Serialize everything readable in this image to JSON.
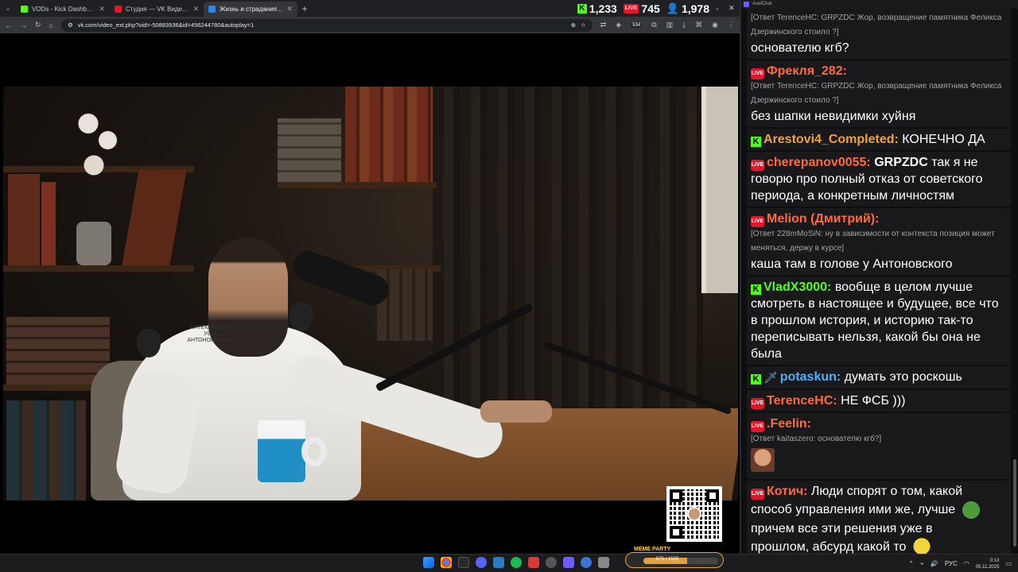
{
  "browser": {
    "tabs": [
      {
        "title": "VODs - Kick Dashboard",
        "favicon_color": "#53fc18",
        "active": false
      },
      {
        "title": "Студия — VK Видео Live",
        "favicon_color": "#e0162b",
        "active": false
      },
      {
        "title": "Жизнь и страдания Роман",
        "favicon_color": "#2787f5",
        "active": true
      }
    ],
    "new_tab": "+",
    "url": "vk.com/video_ext.php?oid=-50883936&id=456244780&autoplay=1",
    "counters": {
      "kick": "1,233",
      "vk": "745",
      "viewers": "1,978"
    },
    "badge": "534"
  },
  "video": {
    "shirt_text": "АПТЕКАРСКИЕ УСЫ АНТОНОВСКОГО"
  },
  "chat": {
    "window_title": "AxelChat",
    "messages": [
      {
        "platform": "",
        "name": "",
        "name_color": "#ffffff",
        "reply": "[Ответ TerenceHC: GRPZDC Жор, возвращение памятника Феликса Дзержинского стоило ?]",
        "body": "основателю кгб?"
      },
      {
        "platform": "vk",
        "name": "Фрекля_282:",
        "name_color": "#ff6a3d",
        "reply": "[Ответ TerenceHC: GRPZDC Жор, возвращение памятника Феликса Дзержинского стоило ?]",
        "body": "без шапки невидимки хуйня"
      },
      {
        "platform": "kick",
        "name": "Arestovi4_Completed:",
        "name_color": "#f0a33b",
        "reply": "",
        "body": "КОНЕЧНО ДА"
      },
      {
        "platform": "vk",
        "name": "cherepanov0055:",
        "name_color": "#ff6a3d",
        "reply": "",
        "body_bold": "GRPZDC",
        "body": " так я не говорю про полный отказ от советского периода, а конкретным личностям"
      },
      {
        "platform": "vk",
        "name": "Melion (Дмитрий):",
        "name_color": "#ff6a3d",
        "reply": "[Ответ 228mMoSiN: ну в зависимости от контекста позиция может меняться, держу в курсе]",
        "body": "каша там в голове у Антоновского"
      },
      {
        "platform": "kick",
        "name": "VladX3000:",
        "name_color": "#53fc18",
        "reply": "",
        "body": "вообще в целом лучше смотреть в настоящее и будущее, все что в прошлом история, и историю так-то переписывать нельзя, какой бы она не была"
      },
      {
        "platform": "kick",
        "name": "potaskun:",
        "name_color": "#4fb0ff",
        "reply": "",
        "body": "думать это роскошь"
      },
      {
        "platform": "vk",
        "name": "TerenceHC:",
        "name_color": "#ff6a3d",
        "reply": "",
        "body": "НЕ ФСБ )))"
      },
      {
        "platform": "vk",
        "name": ".Feelin:",
        "name_color": "#ff6a3d",
        "reply": "[Ответ kaitaszero: основателю кгб?]",
        "body": ""
      },
      {
        "platform": "vk",
        "name": "Котич:",
        "name_color": "#ff6a3d",
        "reply": "",
        "body_lines": [
          "Люди спорят о том, какой способ управления ими же, лучше",
          "причем все эти решения уже в",
          "прошлом, абсурд какой то"
        ]
      }
    ],
    "platform_labels": {
      "kick": "K",
      "vk": "LIVE"
    }
  },
  "taskbar": {
    "meme_title": "MEME PARTY",
    "meme_progress_text": "875 / 1500",
    "meme_progress": 0.583,
    "lang": "РУС",
    "time": "0:13",
    "date": "05.11.2025"
  }
}
